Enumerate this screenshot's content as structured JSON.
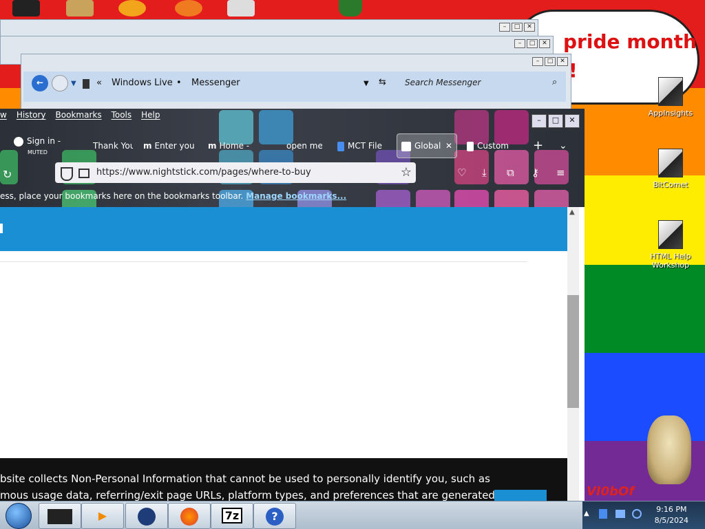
{
  "desktop": {
    "banner_line1": "pride month",
    "banner_line2": "!",
    "icons": [
      {
        "label": "AppInsights"
      },
      {
        "label": "BitComet"
      },
      {
        "label": "HTML Help Workshop"
      }
    ],
    "stripe_text": "VI0bOf"
  },
  "messenger": {
    "crumb1": "Windows Live",
    "crumb_sep": "•",
    "crumb2": "Messenger",
    "search_placeholder": "Search Messenger",
    "chevrons": "«"
  },
  "firefox": {
    "menu": [
      "w",
      "History",
      "Bookmarks",
      "Tools",
      "Help"
    ],
    "tabs": [
      {
        "label": "Sign in -",
        "sub": "MUTED"
      },
      {
        "label": "Thank You"
      },
      {
        "label": "Enter you"
      },
      {
        "label": "Home -"
      },
      {
        "label": "open me"
      },
      {
        "label": "MCT File"
      },
      {
        "label": "Global"
      },
      {
        "label": "Custom"
      }
    ],
    "new_tab": "+",
    "tab_list": "⌄",
    "close_tab": "✕",
    "url": "https://www.nightstick.com/pages/where-to-buy",
    "bookmarks_text": "ess, place your bookmarks here on the bookmarks toolbar.",
    "bookmarks_link": "Manage bookmarks...",
    "cookie_line1": "bsite collects Non-Personal Information that cannot be used to personally identify you, such as",
    "cookie_line2": "mous usage data, referring/exit page URLs, platform types, and preferences that are generated"
  },
  "taskbar": {
    "time": "9:16 PM",
    "date": "8/5/2024",
    "apps": [
      "terminal",
      "media-player",
      "globe",
      "firefox",
      "7z",
      "help"
    ],
    "app_7z_label": "7z",
    "app_help_label": "?"
  },
  "colors": {
    "banner_blue": "#1b8fd4",
    "cookie_bg": "#111111"
  }
}
